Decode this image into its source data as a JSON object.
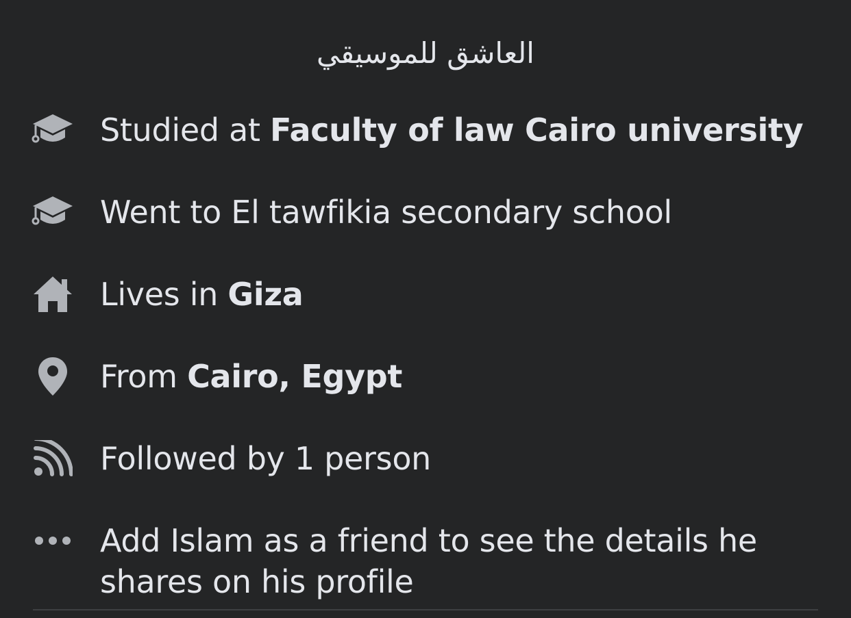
{
  "profile": {
    "bio": "العاشق للموسيقي"
  },
  "intro": {
    "items": [
      {
        "icon": "graduation-cap-icon",
        "prefix": "Studied at ",
        "highlight": "Faculty of law Cairo university"
      },
      {
        "icon": "graduation-cap-icon",
        "prefix": "Went to El tawfikia secondary school",
        "highlight": ""
      },
      {
        "icon": "home-icon",
        "prefix": "Lives in ",
        "highlight": "Giza"
      },
      {
        "icon": "location-pin-icon",
        "prefix": "From ",
        "highlight": "Cairo, Egypt"
      },
      {
        "icon": "rss-feed-icon",
        "prefix": "Followed by 1 person",
        "highlight": ""
      },
      {
        "icon": "more-dots-icon",
        "prefix": "Add Islam as a friend to see the details he shares on his profile",
        "highlight": ""
      }
    ]
  },
  "colors": {
    "background": "#242526",
    "text": "#e4e6eb",
    "icon": "#b0b3b8",
    "divider": "#3e4042"
  }
}
